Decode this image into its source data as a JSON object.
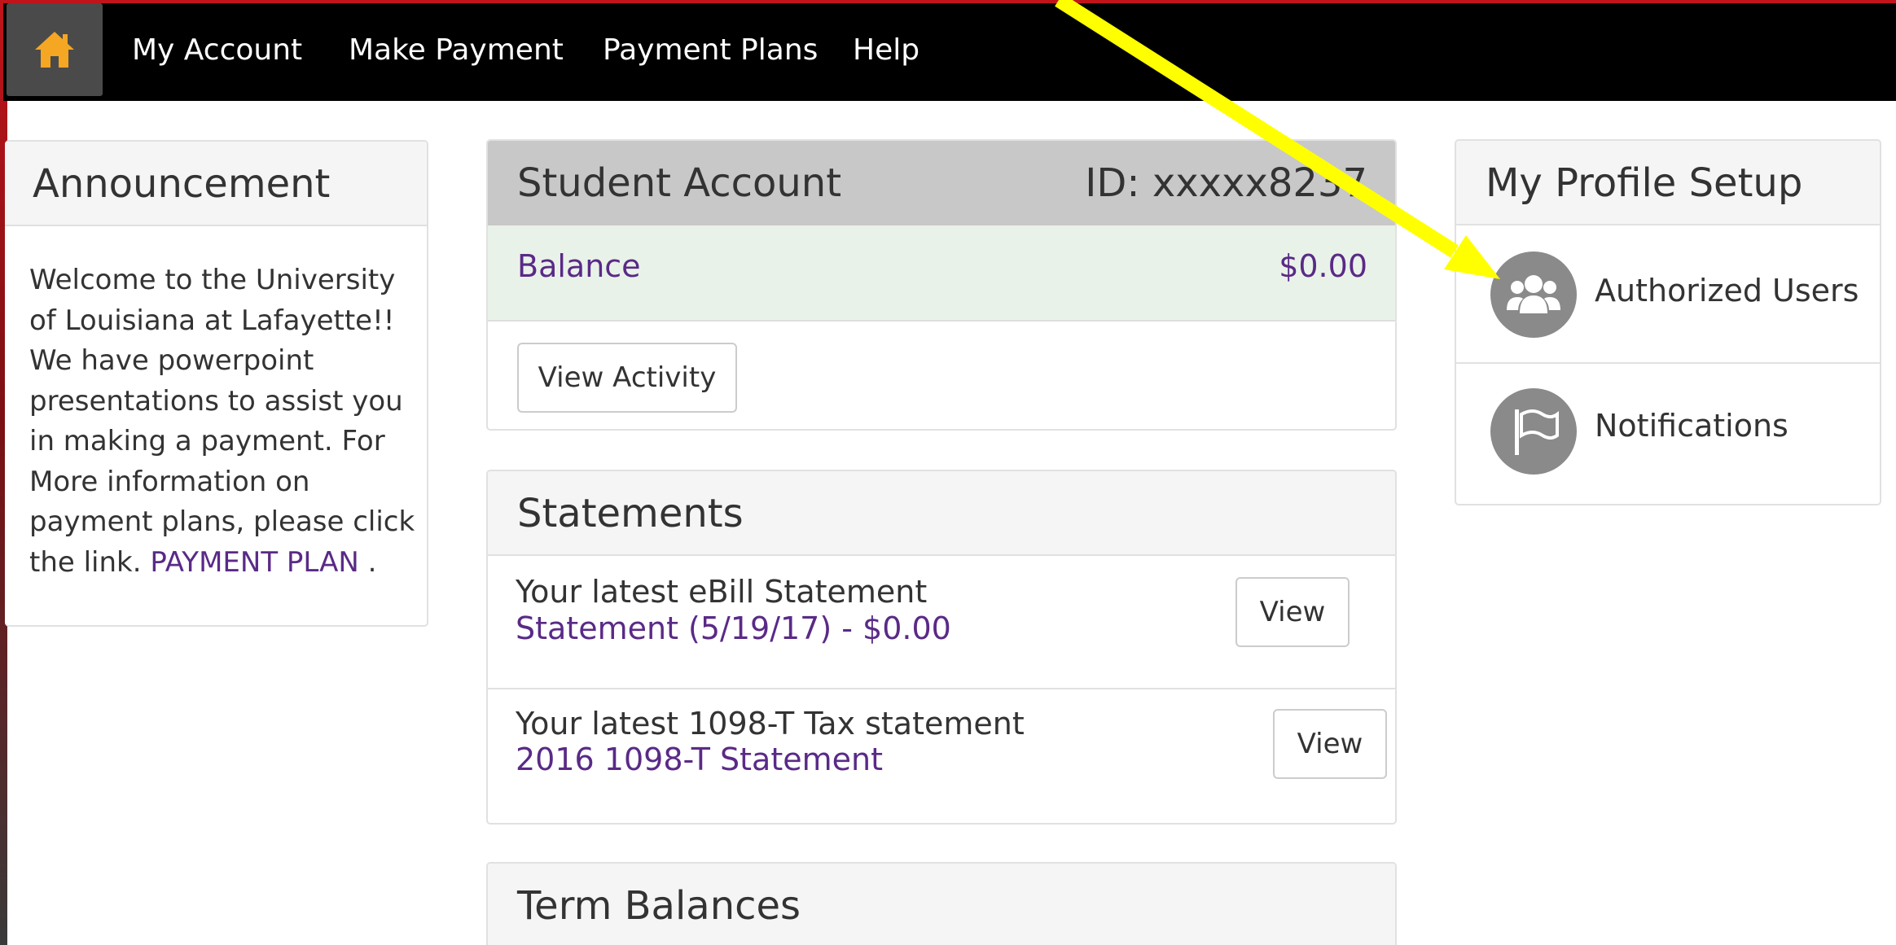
{
  "nav": {
    "home_icon": "home-icon",
    "items": [
      "My Account",
      "Make Payment",
      "Payment Plans",
      "Help"
    ]
  },
  "announcement": {
    "title": "Announcement",
    "body": "Welcome to the University of Louisiana at Lafayette!! We have powerpoint presentations to assist you in making a payment. For More information on payment plans, please click the link. ",
    "link_text": "PAYMENT PLAN",
    "trailing": " ."
  },
  "student_account": {
    "title": "Student Account",
    "id_text": "ID: xxxxx8237",
    "balance_label": "Balance",
    "balance_value": "$0.00",
    "view_activity_label": "View Activity"
  },
  "statements": {
    "title": "Statements",
    "ebill_caption": "Your latest eBill Statement",
    "ebill_link": "Statement (5/19/17) - $0.00",
    "ebill_button": "View",
    "tax_caption": "Your latest 1098-T Tax statement",
    "tax_link": "2016 1098-T Statement",
    "tax_button": "View"
  },
  "term_balances": {
    "title": "Term Balances"
  },
  "profile": {
    "title": "My Profile Setup",
    "authorized_users_label": "Authorized Users",
    "authorized_users_icon": "users-icon",
    "notifications_label": "Notifications",
    "notifications_icon": "flag-icon"
  },
  "colors": {
    "nav_bg": "#000000",
    "home_accent": "#f5a623",
    "link": "#5a2a87",
    "balance_bg": "#e9f2e8",
    "student_header_bg": "#c8c8c8",
    "annotation_arrow": "#ffff00",
    "frame_red": "#c0141a"
  }
}
